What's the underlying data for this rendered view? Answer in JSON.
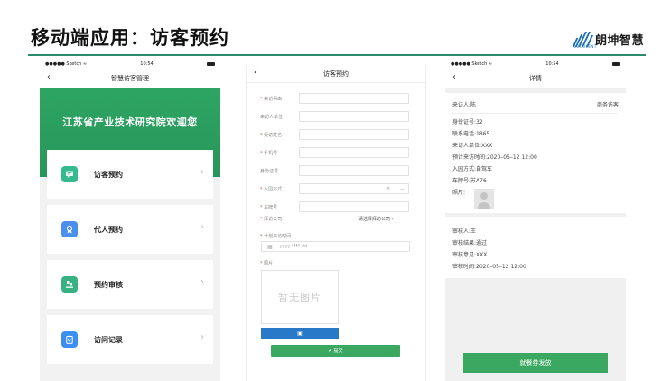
{
  "slide": {
    "title": "移动端应用：访客预约",
    "logo_text": "朗坤智慧",
    "logo_sub": "LUCULENT",
    "accent": "#2a8a6a"
  },
  "phone1": {
    "status": {
      "carrier": "●●●●● Sketch ≈",
      "time": "10:54"
    },
    "nav_title": "智慧访客管理",
    "banner_title": "江苏省产业技术研究院欢迎您",
    "banner_color": "#2ea563",
    "menu": [
      {
        "label": "访客预约",
        "icon": "chat-icon",
        "color": "#35b98e"
      },
      {
        "label": "代人预约",
        "icon": "badge-icon",
        "color": "#4a8ef0"
      },
      {
        "label": "预约审核",
        "icon": "stamp-icon",
        "color": "#3ab183"
      },
      {
        "label": "访问记录",
        "icon": "clipboard-check-icon",
        "color": "#3b8ff0"
      }
    ]
  },
  "phone2": {
    "nav_title": "访客预约",
    "fields": [
      {
        "label": "来访事由",
        "required": true
      },
      {
        "label": "来访人单位",
        "required": false
      },
      {
        "label": "受访姓名",
        "required": true
      },
      {
        "label": "手机号",
        "required": true
      },
      {
        "label": "身份证号",
        "required": false
      },
      {
        "label": "入园方式",
        "required": true
      },
      {
        "label": "车牌号",
        "required": true
      }
    ],
    "entry_mark_x": "×",
    "entry_mark_dash": "－",
    "company_label": "拜访公司",
    "company_placeholder": "请选择拜访公司",
    "company_chevron": "›",
    "time_label": "计划来访时间",
    "date_placeholder": "yyyy-MM-dd",
    "photo_label": "图片",
    "photo_placeholder": "暂无图片",
    "submit_label": "提交"
  },
  "phone3": {
    "status": {
      "carrier": "●●●●● Sketch ≈",
      "time": "10:54"
    },
    "nav_title": "详情",
    "visitor": "来访人:陈",
    "visit_type": "商务访客",
    "lines": [
      "身份证号:32",
      "联系电话:1865",
      "来访人单位:XXX",
      "预计来访时间:2020–05–12 12:00",
      "入园方式:自驾车",
      "车牌号:苏A76"
    ],
    "photo_label": "照片:",
    "review_lines": [
      "审核人:王",
      "审核结果:通过",
      "审核意见:XXX",
      "审核时间:2020–05–12 12:00"
    ],
    "issue_button": "就餐券发放"
  }
}
